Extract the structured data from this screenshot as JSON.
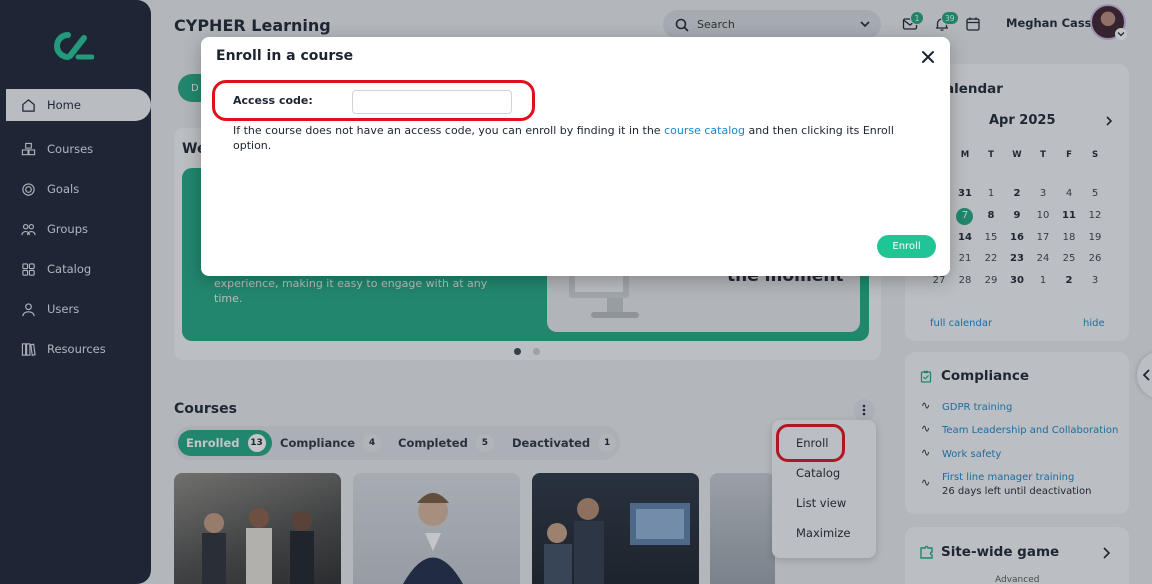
{
  "app": {
    "title": "CYPHER Learning"
  },
  "sidebar": {
    "items": [
      {
        "label": "Home",
        "icon": "home-icon",
        "active": true
      },
      {
        "label": "Courses",
        "icon": "courses-icon"
      },
      {
        "label": "Goals",
        "icon": "goals-icon"
      },
      {
        "label": "Groups",
        "icon": "groups-icon"
      },
      {
        "label": "Catalog",
        "icon": "catalog-icon"
      },
      {
        "label": "Users",
        "icon": "user-icon"
      },
      {
        "label": "Resources",
        "icon": "resources-icon"
      }
    ]
  },
  "header": {
    "search_label": "Search",
    "inbox_badge": "1",
    "notifications_badge": "39",
    "user_name": "Meghan Cass"
  },
  "main": {
    "dashboard_pill": "D",
    "welcome_partial": "We",
    "welcome_text": "experience, making it easy to engage with at any time.",
    "welcome_image_text": "the moment",
    "courses_title": "Courses",
    "tabs": [
      {
        "label": "Enrolled",
        "count": "13",
        "active": true
      },
      {
        "label": "Compliance",
        "count": "4"
      },
      {
        "label": "Completed",
        "count": "5"
      },
      {
        "label": "Deactivated",
        "count": "1"
      }
    ],
    "course_menu": [
      "Enroll",
      "Catalog",
      "List view",
      "Maximize"
    ]
  },
  "calendar": {
    "title": "Calendar",
    "title_visible": "alendar",
    "month": "Apr 2025",
    "weekdays": [
      "M",
      "T",
      "W",
      "T",
      "F",
      "S"
    ],
    "rows": [
      [
        "31",
        "1",
        "2",
        "3",
        "4",
        "5"
      ],
      [
        "7",
        "8",
        "9",
        "10",
        "11",
        "12"
      ],
      [
        "14",
        "15",
        "16",
        "17",
        "18",
        "19"
      ],
      [
        "21",
        "22",
        "23",
        "24",
        "25",
        "26"
      ],
      [
        "27",
        "28",
        "29",
        "30",
        "1",
        "2",
        "3"
      ]
    ],
    "today": "7",
    "full_calendar_link": "full calendar",
    "hide_link": "hide"
  },
  "compliance": {
    "title": "Compliance",
    "items": [
      "GDPR training",
      "Team Leadership and Collaboration",
      "Work safety",
      "First line manager training"
    ],
    "last_item_note": "26 days left until deactivation"
  },
  "game": {
    "title": "Site-wide game",
    "subtitle": "Advanced"
  },
  "modal": {
    "title": "Enroll in a course",
    "access_code_label": "Access code:",
    "access_code_value": "",
    "help_before": "If the course does not have an access code, you can enroll by finding it in the ",
    "help_link": "course catalog",
    "help_after": " and then clicking its Enroll option.",
    "enroll_button": "Enroll"
  },
  "colors": {
    "accent": "#21a882",
    "sidebar_bg": "#1b2233",
    "link": "#1b86c7",
    "highlight_ring": "#e3101b"
  }
}
